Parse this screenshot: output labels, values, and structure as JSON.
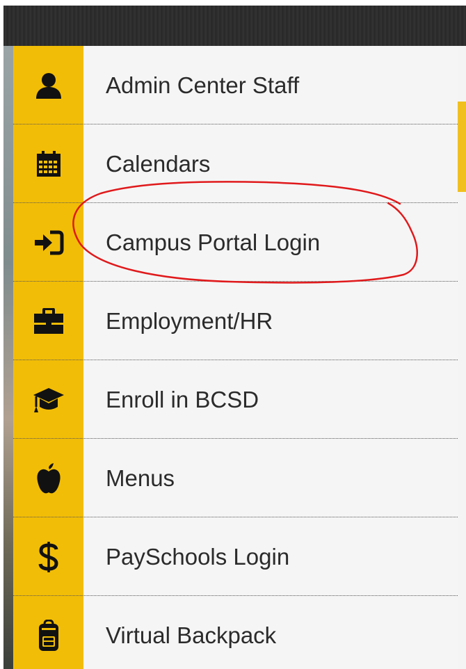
{
  "menu": {
    "items": [
      {
        "label": "Admin Center Staff",
        "icon": "user-icon"
      },
      {
        "label": "Calendars",
        "icon": "calendar-icon"
      },
      {
        "label": "Campus Portal Login",
        "icon": "sign-in-icon"
      },
      {
        "label": "Employment/HR",
        "icon": "briefcase-icon"
      },
      {
        "label": "Enroll in BCSD",
        "icon": "graduation-cap-icon"
      },
      {
        "label": "Menus",
        "icon": "apple-icon"
      },
      {
        "label": "PaySchools Login",
        "icon": "dollar-icon"
      },
      {
        "label": "Virtual Backpack",
        "icon": "backpack-icon"
      }
    ]
  },
  "colors": {
    "icon_column": "#f2bd06",
    "menu_background": "#f5f5f5",
    "annotation_circle": "#e0191b"
  },
  "annotation": {
    "shape": "hand-drawn-circle",
    "target": "Campus Portal Login"
  }
}
